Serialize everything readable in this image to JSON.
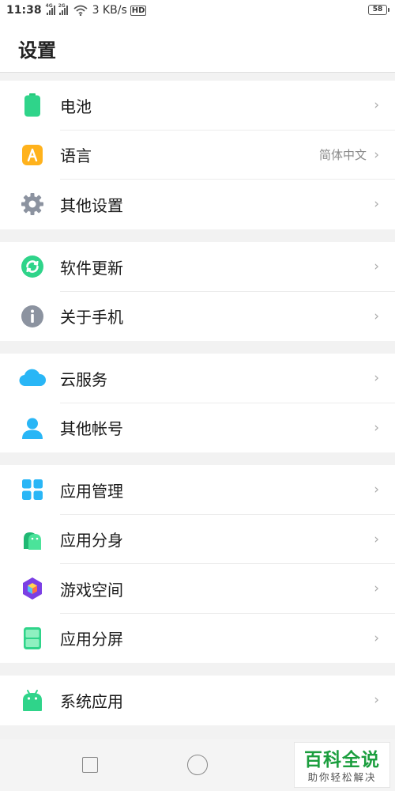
{
  "status_bar": {
    "time": "11:38",
    "sim1_tag": "4G",
    "sim2_tag": "2G",
    "network_speed": "3 KB/s",
    "hd_label": "HD",
    "battery_level": "58"
  },
  "header": {
    "title": "设置"
  },
  "groups": [
    {
      "items": [
        {
          "label": "电池",
          "icon": "battery-icon",
          "value": ""
        },
        {
          "label": "语言",
          "icon": "language-icon",
          "value": "简体中文"
        },
        {
          "label": "其他设置",
          "icon": "gear-icon",
          "value": ""
        }
      ]
    },
    {
      "items": [
        {
          "label": "软件更新",
          "icon": "update-icon",
          "value": ""
        },
        {
          "label": "关于手机",
          "icon": "info-icon",
          "value": ""
        }
      ]
    },
    {
      "items": [
        {
          "label": "云服务",
          "icon": "cloud-icon",
          "value": ""
        },
        {
          "label": "其他帐号",
          "icon": "account-icon",
          "value": ""
        }
      ]
    },
    {
      "items": [
        {
          "label": "应用管理",
          "icon": "app-grid-icon",
          "value": ""
        },
        {
          "label": "应用分身",
          "icon": "app-clone-icon",
          "value": ""
        },
        {
          "label": "游戏空间",
          "icon": "game-space-icon",
          "value": ""
        },
        {
          "label": "应用分屏",
          "icon": "split-screen-icon",
          "value": ""
        }
      ]
    },
    {
      "items": [
        {
          "label": "系统应用",
          "icon": "android-icon",
          "value": ""
        }
      ]
    }
  ],
  "chevron": "›",
  "watermark": {
    "main": "百科全说",
    "sub": "助你轻松解决"
  },
  "colors": {
    "accent_green": "#2fd48a",
    "watermark_green": "#1b9e3e",
    "separator": "#ececec"
  }
}
